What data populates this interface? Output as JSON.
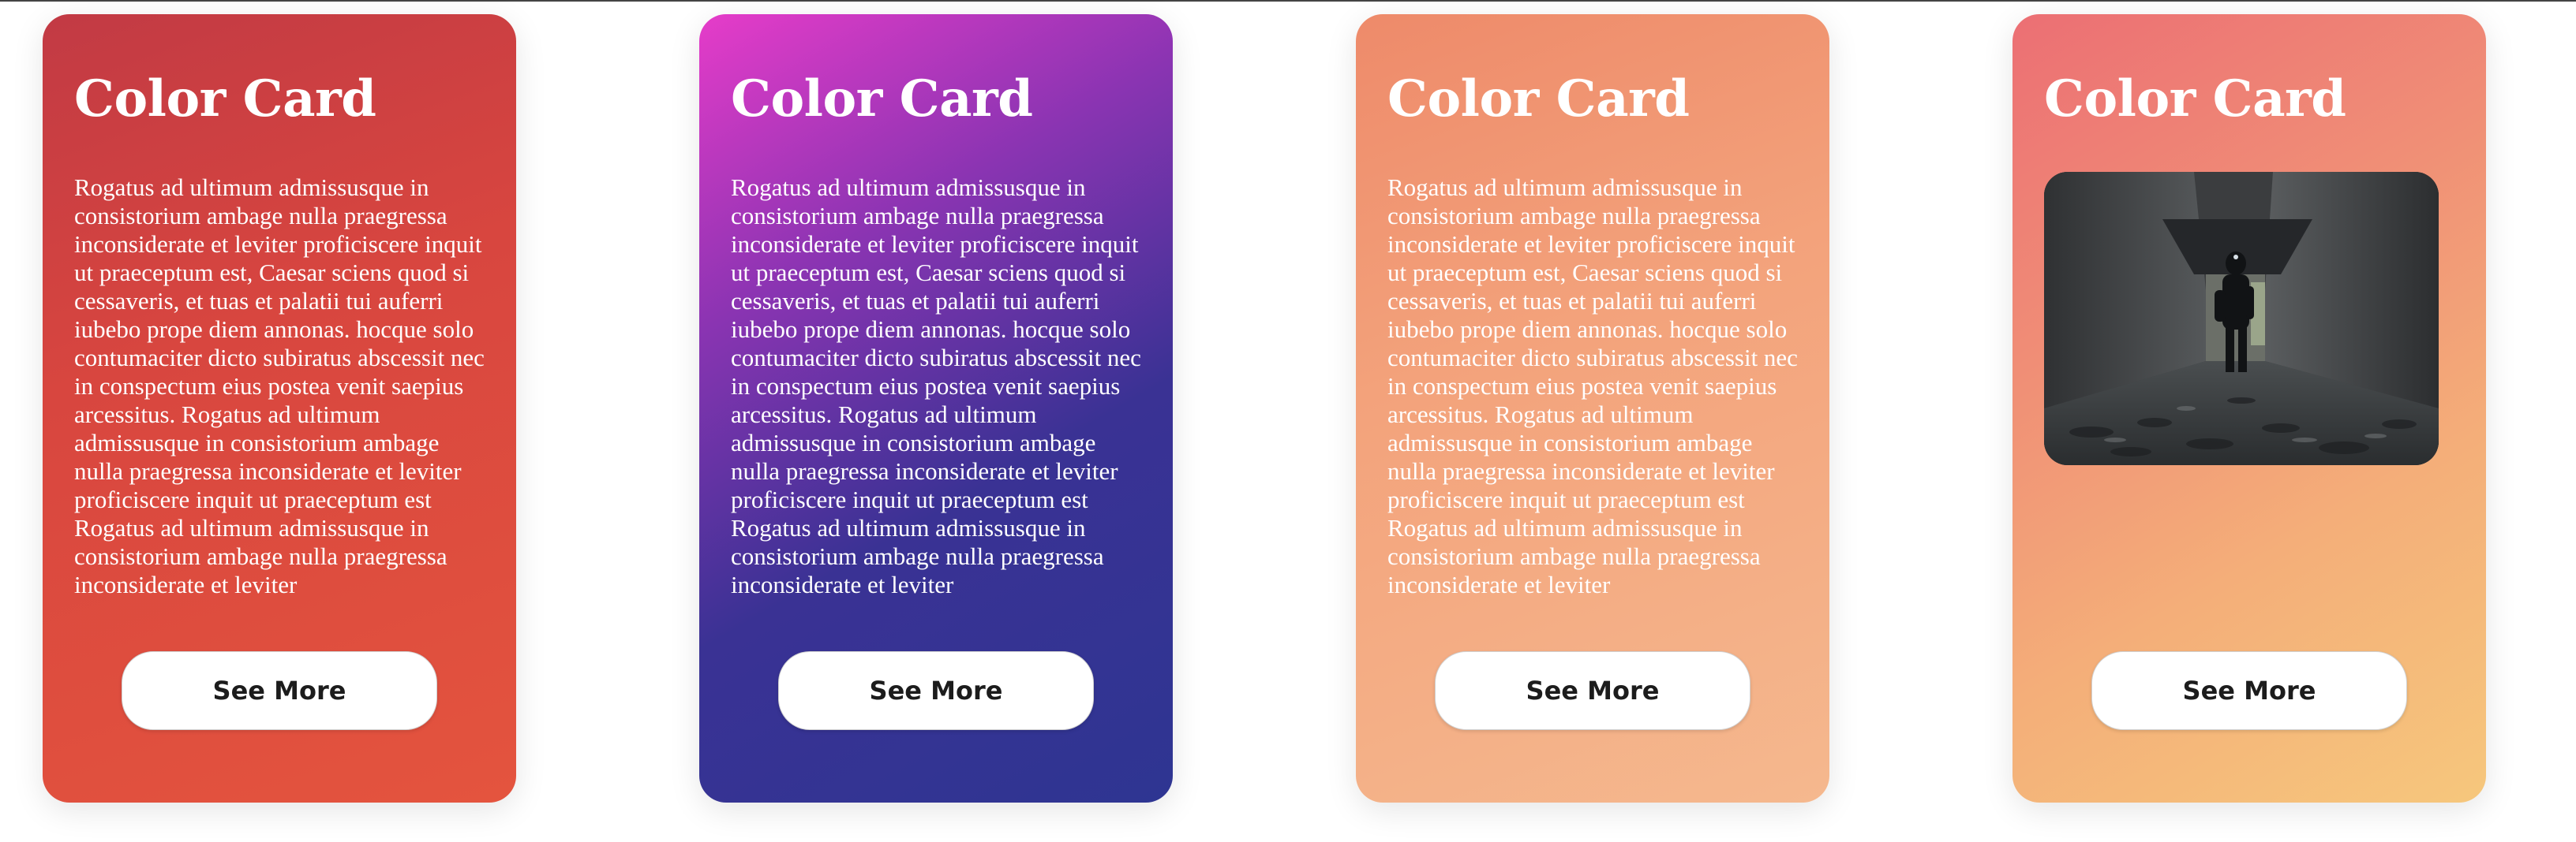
{
  "cards": [
    {
      "title": "Color Card",
      "body": "Rogatus ad ultimum admissusque in consistorium ambage nulla praegressa inconsiderate et leviter proficiscere inquit ut praeceptum est, Caesar sciens quod si cessaveris, et tuas et palatii tui auferri iubebo prope diem annonas. hocque solo contumaciter dicto subiratus abscessit nec in conspectum eius postea venit saepius arcessitus. Rogatus ad ultimum admissusque in consistorium ambage nulla praegressa inconsiderate et leviter proficiscere inquit ut praeceptum est Rogatus ad ultimum admissusque in consistorium ambage nulla praegressa inconsiderate et leviter",
      "button_label": "See More",
      "gradient": [
        "#c23a44",
        "#e4543e"
      ]
    },
    {
      "title": "Color Card",
      "body": "Rogatus ad ultimum admissusque in consistorium ambage nulla praegressa inconsiderate et leviter proficiscere inquit ut praeceptum est, Caesar sciens quod si cessaveris, et tuas et palatii tui auferri iubebo prope diem annonas. hocque solo contumaciter dicto subiratus abscessit nec in conspectum eius postea venit saepius arcessitus. Rogatus ad ultimum admissusque in consistorium ambage nulla praegressa inconsiderate et leviter proficiscere inquit ut praeceptum est Rogatus ad ultimum admissusque in consistorium ambage nulla praegressa inconsiderate et leviter",
      "button_label": "See More",
      "gradient": [
        "#e63cc9",
        "#2e3592"
      ]
    },
    {
      "title": "Color Card",
      "body": "Rogatus ad ultimum admissusque in consistorium ambage nulla praegressa inconsiderate et leviter proficiscere inquit ut praeceptum est, Caesar sciens quod si cessaveris, et tuas et palatii tui auferri iubebo prope diem annonas. hocque solo contumaciter dicto subiratus abscessit nec in conspectum eius postea venit saepius arcessitus. Rogatus ad ultimum admissusque in consistorium ambage nulla praegressa inconsiderate et leviter proficiscere inquit ut praeceptum est Rogatus ad ultimum admissusque in consistorium ambage nulla praegressa inconsiderate et leviter",
      "button_label": "See More",
      "gradient": [
        "#ee8a6a",
        "#f5b88e"
      ]
    },
    {
      "title": "Color Card",
      "image": "photo-figure-in-concrete-corridor",
      "button_label": "See More",
      "gradient": [
        "#ec6f74",
        "#f6c77c"
      ]
    }
  ],
  "colors": {
    "text": "#ffffff",
    "button_bg": "#ffffff",
    "button_text": "#1c1c1c"
  }
}
